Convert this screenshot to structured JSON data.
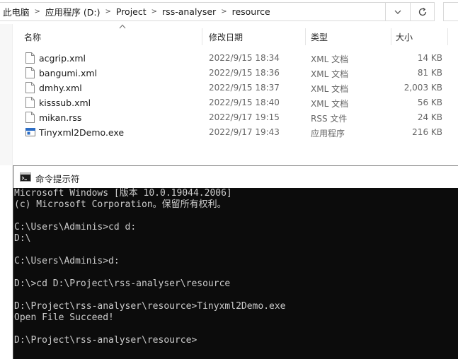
{
  "explorer": {
    "breadcrumb": [
      "此电脑",
      "应用程序 (D:)",
      "Project",
      "rss-analyser",
      "resource"
    ],
    "columns": {
      "name": "名称",
      "modified": "修改日期",
      "type": "类型",
      "size": "大小"
    },
    "files": [
      {
        "name": "acgrip.xml",
        "modified": "2022/9/15 18:34",
        "type": "XML 文档",
        "size": "14 KB",
        "icon": "xml-file-icon"
      },
      {
        "name": "bangumi.xml",
        "modified": "2022/9/15 18:36",
        "type": "XML 文档",
        "size": "81 KB",
        "icon": "xml-file-icon"
      },
      {
        "name": "dmhy.xml",
        "modified": "2022/9/15 18:37",
        "type": "XML 文档",
        "size": "2,003 KB",
        "icon": "xml-file-icon"
      },
      {
        "name": "kisssub.xml",
        "modified": "2022/9/15 18:40",
        "type": "XML 文档",
        "size": "56 KB",
        "icon": "xml-file-icon"
      },
      {
        "name": "mikan.rss",
        "modified": "2022/9/17 19:15",
        "type": "RSS 文件",
        "size": "24 KB",
        "icon": "rss-file-icon"
      },
      {
        "name": "Tinyxml2Demo.exe",
        "modified": "2022/9/17 19:43",
        "type": "应用程序",
        "size": "216 KB",
        "icon": "exe-file-icon"
      }
    ]
  },
  "cmd": {
    "title": "命令提示符",
    "lines": [
      "Microsoft Windows [版本 10.0.19044.2006]",
      "(c) Microsoft Corporation。保留所有权利。",
      "",
      "C:\\Users\\Adminis>cd d:",
      "D:\\",
      "",
      "C:\\Users\\Adminis>d:",
      "",
      "D:\\>cd D:\\Project\\rss-analyser\\resource",
      "",
      "D:\\Project\\rss-analyser\\resource>Tinyxml2Demo.exe",
      "Open File Succeed!",
      "",
      "D:\\Project\\rss-analyser\\resource>"
    ]
  },
  "colors": {
    "cmd_background": "#0c0c0c",
    "cmd_text": "#cccccc",
    "exe_icon_blue": "#2b6cc4"
  }
}
